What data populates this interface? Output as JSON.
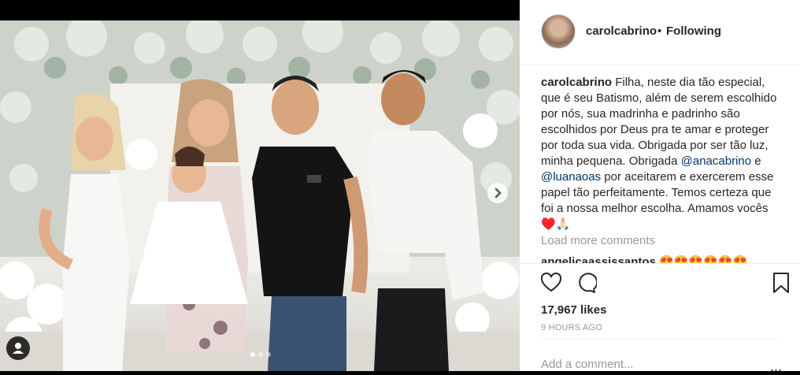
{
  "post": {
    "username": "carolcabrino",
    "separator": "•",
    "follow_status": "Following",
    "caption_user": "carolcabrino",
    "caption_part1": " Filha, neste dia tão especial, que é seu Batismo, além de serem escolhido por nós, sua madrinha e padrinho são escolhidos por Deus pra te amar e proteger por toda sua vida. Obrigada por ser tão luz, minha pequena. Obrigada ",
    "mention1": "@anacabrino",
    "caption_part2": " e ",
    "mention2": "@luanaoas",
    "caption_part3": " por aceitarem e exercerem esse papel tão perfeitamente. Temos certeza que foi a nossa melhor escolha. Amamos vocês ♥️🙏🏻",
    "load_more": "Load more comments",
    "next_comment_preview": "angelicaassissantos 😍😍😍😍😍😍",
    "likes": "17,967 likes",
    "timestamp": "9 HOURS AGO",
    "add_comment_placeholder": "Add a comment...",
    "more_options": "..."
  },
  "carousel": {
    "slide_count": 3,
    "active_index": 0
  },
  "icons": {
    "like": "heart-icon",
    "comment": "speech-bubble-icon",
    "save": "bookmark-icon",
    "next": "chevron-right-icon",
    "tagged": "user-tag-icon"
  },
  "colors": {
    "text": "#262626",
    "muted": "#999999",
    "link": "#003569",
    "border": "#efefef"
  }
}
